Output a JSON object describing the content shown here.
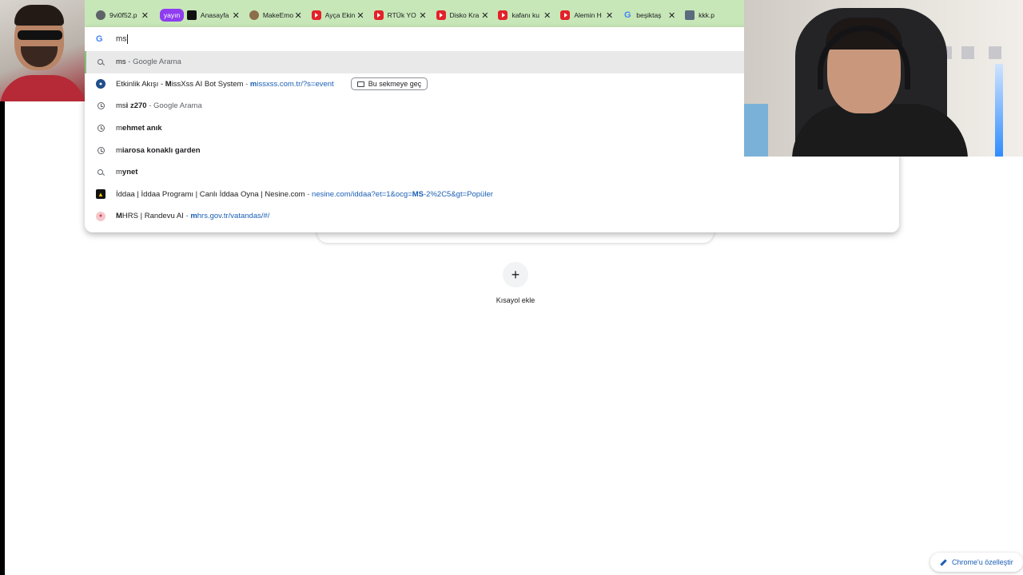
{
  "tabs": [
    {
      "title": "9vi0f52.p",
      "icon": "globe-icon",
      "close": "✕"
    },
    {
      "title": "yayın",
      "type": "group-pill",
      "color": "#8e3df0"
    },
    {
      "title": "Anasayfa",
      "icon": "x-icon",
      "close": "✕"
    },
    {
      "title": "MakeEmo",
      "icon": "emoji-icon",
      "close": "✕"
    },
    {
      "title": "Ayça Ekin",
      "icon": "youtube-icon",
      "close": "✕"
    },
    {
      "title": "RTÜk YO",
      "icon": "youtube-icon",
      "close": "✕"
    },
    {
      "title": "Disko Kra",
      "icon": "youtube-icon",
      "close": "✕"
    },
    {
      "title": "kafanı ku",
      "icon": "youtube-icon",
      "close": "✕"
    },
    {
      "title": "Alemin H",
      "icon": "youtube-icon",
      "close": "✕"
    },
    {
      "title": "beşiktaş",
      "icon": "google-icon",
      "close": "✕"
    },
    {
      "title": "kkk.p",
      "icon": "doc-icon"
    }
  ],
  "omnibox": {
    "typed": "ms",
    "google_letter": "G"
  },
  "suggestions": [
    {
      "icon": "search-icon",
      "prefix": "ms",
      "bold": "",
      "suffix": " - Google Arama",
      "selected": true
    },
    {
      "icon": "site-icon",
      "title_pre": "Etkinlik Akışı - ",
      "title_bold": "M",
      "title_post": "issXss AI Bot System",
      "sep": " - ",
      "url_bold": "m",
      "url_post": "issxss.com.tr/?s=event",
      "button": "Bu sekmeye geç"
    },
    {
      "icon": "history-icon",
      "prefix": "ms",
      "bold": "i z270",
      "suffix": " - Google Arama"
    },
    {
      "icon": "history-icon",
      "prefix": "m",
      "bold": "ehmet anık",
      "suffix": ""
    },
    {
      "icon": "history-icon",
      "prefix": "m",
      "bold": "iarosa konaklı garden",
      "suffix": ""
    },
    {
      "icon": "search-icon",
      "prefix": "m",
      "bold": "ynet",
      "suffix": ""
    },
    {
      "icon": "site-icon",
      "title": "İddaa | İddaa Programı | Canlı İddaa Oyna | Nesine.com",
      "sep": " - ",
      "url_pre": "nesine.com/iddaa?et=1&ocg=",
      "url_bold": "MS",
      "url_post": "-2%2C5&gt=Popüler"
    },
    {
      "icon": "site-icon",
      "title_bold": "M",
      "title_post": "HRS | Randevu AI",
      "sep": " - ",
      "url_bold": "m",
      "url_post": "hrs.gov.tr/vatandas/#/"
    }
  ],
  "shortcut": {
    "plus": "+",
    "label": "Kısayol ekle"
  },
  "customize": {
    "label": "Chrome'u özelleştir"
  },
  "colors": {
    "tabbar": "#c7e7b8",
    "url": "#1a5fb4",
    "group_pill": "#8e3df0"
  }
}
